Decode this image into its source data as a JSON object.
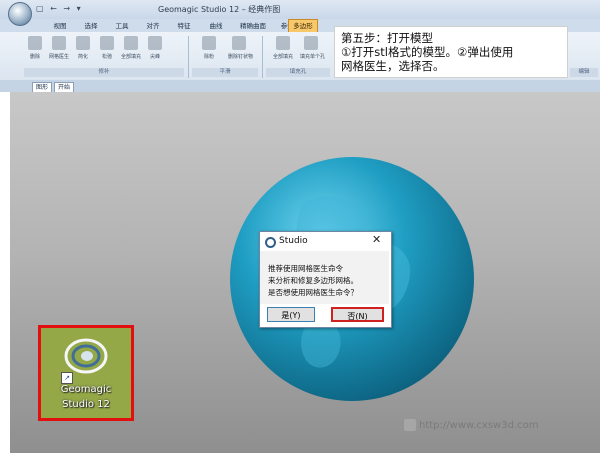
{
  "window": {
    "title": "Geomagic Studio 12 – 经典作图",
    "quick_access": "▢ ← → ▾"
  },
  "ribbon": {
    "tabs": [
      "视图",
      "选择",
      "工具",
      "对齐",
      "特征",
      "曲线",
      "精确曲面",
      "参数化曲面",
      "多边形"
    ],
    "active_tab": "多边形",
    "tools": [
      "删除",
      "网格医生",
      "简化",
      "松弛",
      "全部填充",
      "尖峰",
      "除粉",
      "删除钉状物",
      "全部填充",
      "填充单个孔"
    ],
    "groups": [
      "修补",
      "平滑",
      "填充孔"
    ],
    "right_group": "编辑"
  },
  "tip": {
    "line1": "第五步：打开模型",
    "line2": "①打开stl格式的模型。②弹出使用",
    "line3": "网格医生，选择否。"
  },
  "doc_tabs": [
    "图形",
    "开始"
  ],
  "dialog": {
    "title": "Studio",
    "close": "✕",
    "line1": "推荐使用网格医生命令",
    "line2": "来分析和修复多边形网格。",
    "line3": "是否想使用网格医生命令？",
    "yes": "是(Y)",
    "no": "否(N)"
  },
  "shortcut": {
    "line1": "Geomagic",
    "line2": "Studio 12"
  },
  "watermark": "http://www.cxsw3d.com",
  "colors": {
    "globe": "#1f9ec3",
    "highlight_red": "#e10f0f",
    "active_tab": "#f7c96a"
  }
}
